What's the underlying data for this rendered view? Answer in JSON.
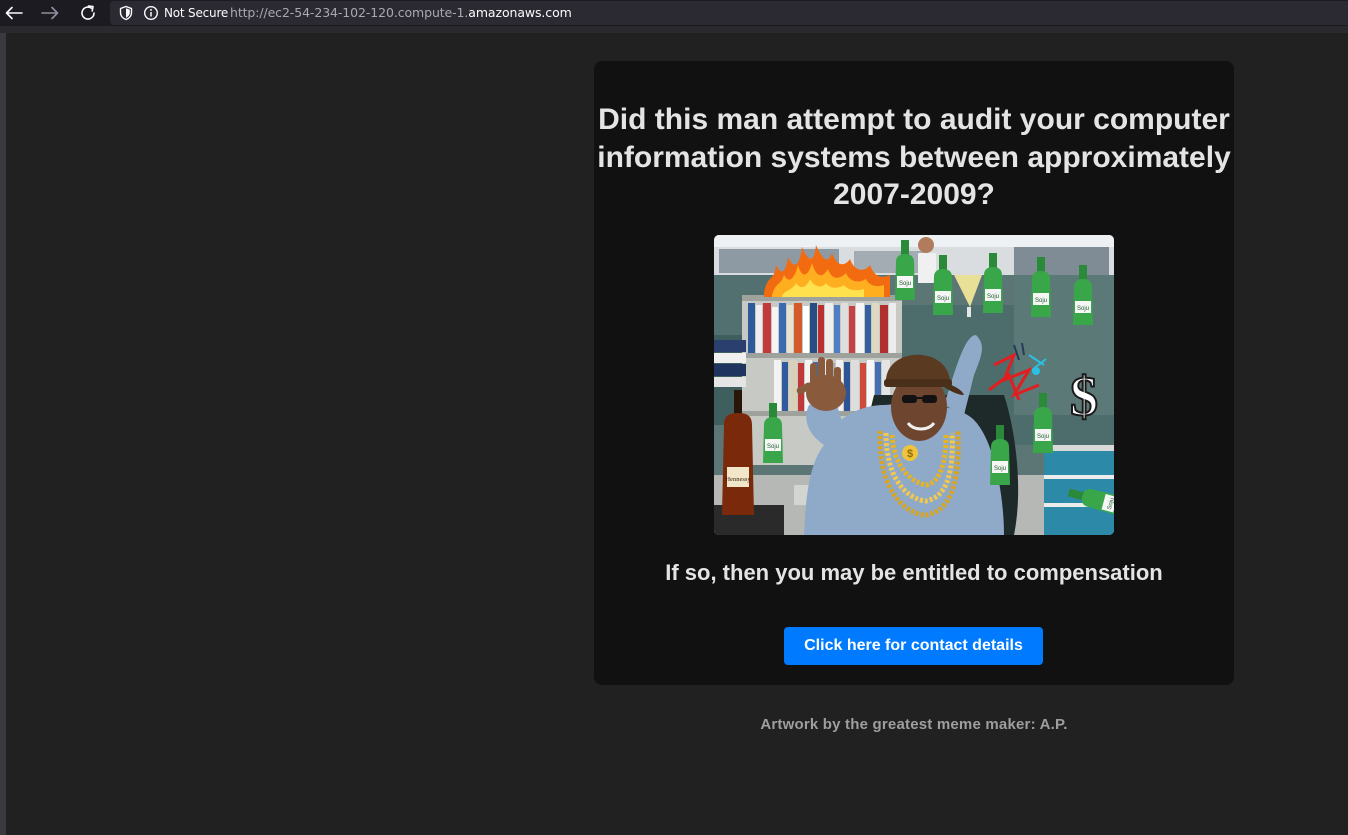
{
  "browser": {
    "security_label": "Not Secure",
    "url_prefix": "http://ec2-54-234-102-120.compute-1.",
    "url_host": "amazonaws.com",
    "icons": {
      "back": "arrow-left-icon",
      "forward": "arrow-right-icon",
      "reload": "reload-icon",
      "tracking": "shield-icon",
      "info": "info-icon"
    }
  },
  "page": {
    "headline": "Did this man attempt to audit your computer information systems between approximately 2007-2009?",
    "subline": "If so, then you may be entitled to compensation",
    "cta_label": "Click here for contact details",
    "credit": "Artwork by the greatest meme maker: A.P."
  },
  "image": {
    "bottle_label": "Soju",
    "brandy_label": "Hennessy",
    "dollar_sign": "$"
  },
  "colors": {
    "page_bg": "#212121",
    "card_bg": "#111111",
    "text": "#e4e4e4",
    "button": "#007bff",
    "credit": "#9e9e9e"
  }
}
